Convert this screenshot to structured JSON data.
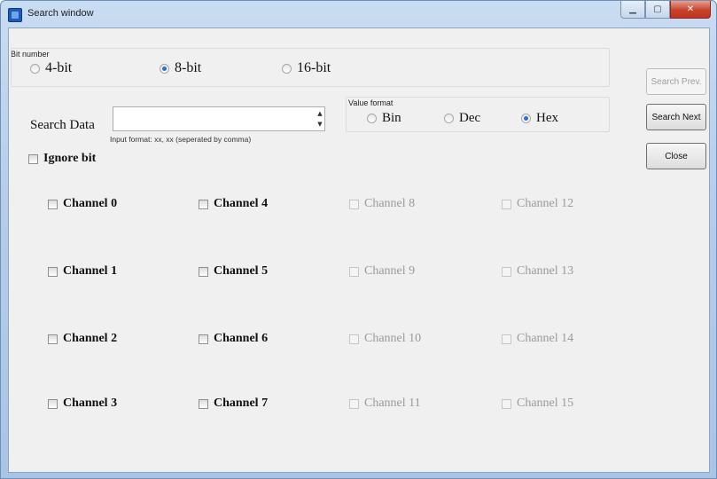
{
  "window": {
    "title": "Search window",
    "controls": {
      "minimize": "▁",
      "maximize": "▢",
      "close": "✕"
    }
  },
  "bit_number": {
    "label": "Bit number",
    "options": [
      "4-bit",
      "8-bit",
      "16-bit"
    ],
    "selected": "8-bit"
  },
  "search": {
    "label": "Search Data",
    "value": "",
    "spin_up": "▲",
    "spin_down": "▼",
    "hint": "Input format: xx, xx (seperated by comma)"
  },
  "value_format": {
    "label": "Value format",
    "options": [
      "Bin",
      "Dec",
      "Hex"
    ],
    "selected": "Hex"
  },
  "ignore_bit": {
    "label": "Ignore bit",
    "checked": false
  },
  "channels": [
    {
      "label": "Channel 0",
      "enabled": true
    },
    {
      "label": "Channel 1",
      "enabled": true
    },
    {
      "label": "Channel 2",
      "enabled": true
    },
    {
      "label": "Channel 3",
      "enabled": true
    },
    {
      "label": "Channel 4",
      "enabled": true
    },
    {
      "label": "Channel 5",
      "enabled": true
    },
    {
      "label": "Channel 6",
      "enabled": true
    },
    {
      "label": "Channel 7",
      "enabled": true
    },
    {
      "label": "Channel 8",
      "enabled": false
    },
    {
      "label": "Channel 9",
      "enabled": false
    },
    {
      "label": "Channel 10",
      "enabled": false
    },
    {
      "label": "Channel 11",
      "enabled": false
    },
    {
      "label": "Channel 12",
      "enabled": false
    },
    {
      "label": "Channel 13",
      "enabled": false
    },
    {
      "label": "Channel 14",
      "enabled": false
    },
    {
      "label": "Channel 15",
      "enabled": false
    }
  ],
  "buttons": {
    "search_prev": "Search Prev.",
    "search_next": "Search Next",
    "close": "Close"
  }
}
